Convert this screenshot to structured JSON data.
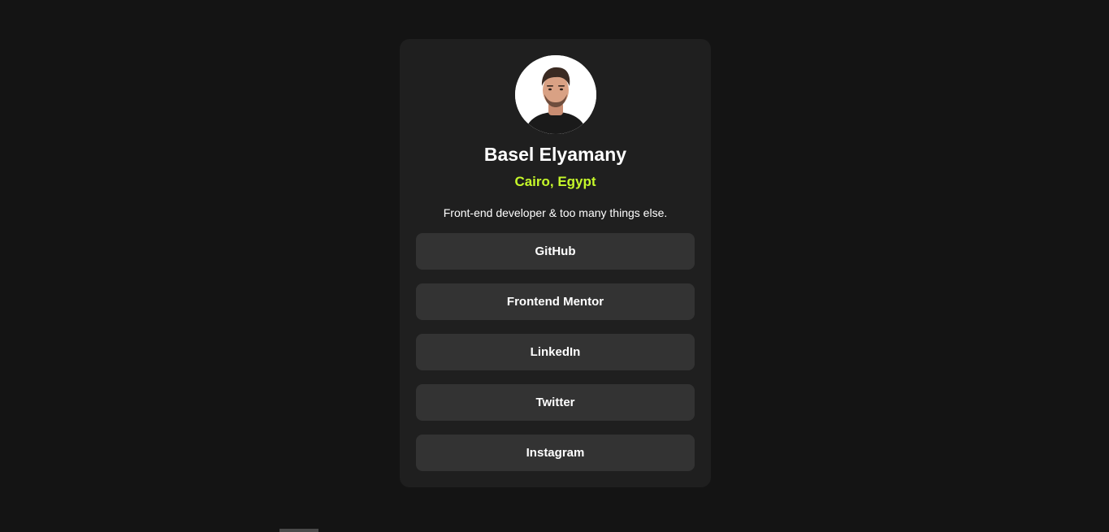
{
  "profile": {
    "name": "Basel Elyamany",
    "location": "Cairo, Egypt",
    "bio": "Front-end developer & too many things else."
  },
  "links": [
    {
      "label": "GitHub"
    },
    {
      "label": "Frontend Mentor"
    },
    {
      "label": "LinkedIn"
    },
    {
      "label": "Twitter"
    },
    {
      "label": "Instagram"
    }
  ],
  "colors": {
    "background": "#141414",
    "card": "#1f1f1f",
    "button": "#333333",
    "accent": "#c5f82a",
    "text": "#ffffff"
  }
}
